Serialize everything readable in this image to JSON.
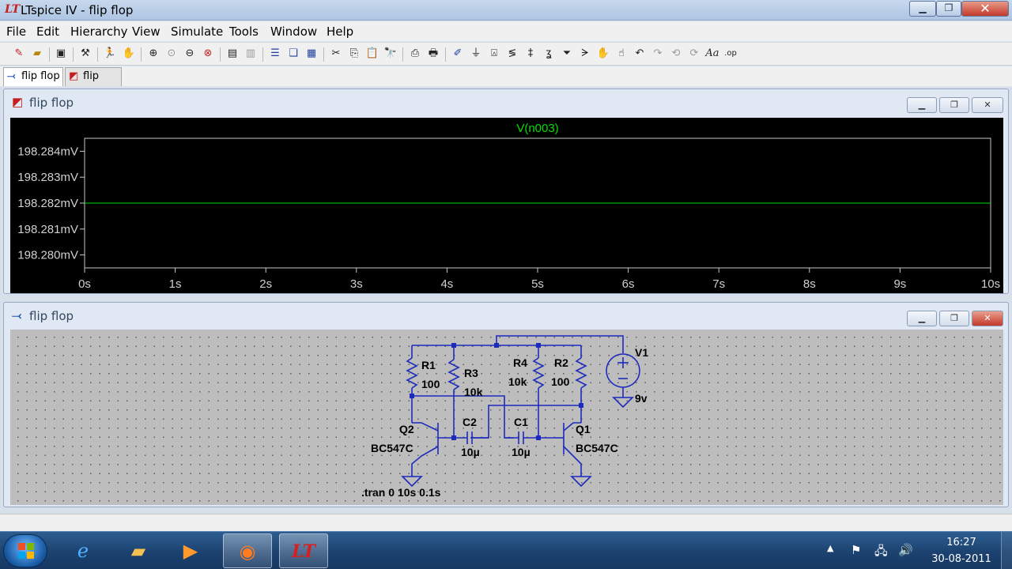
{
  "window": {
    "icon": "LT",
    "title": "LTspice IV - flip flop",
    "min_glyph": "▁",
    "max_glyph": "❐",
    "close_glyph": "✕"
  },
  "menu": {
    "file": "File",
    "edit": "Edit",
    "hierarchy": "Hierarchy",
    "view": "View",
    "simulate": "Simulate",
    "tools": "Tools",
    "window": "Window",
    "help": "Help"
  },
  "toolbar_icons": [
    "new-schematic-icon",
    "open-icon",
    "save-icon",
    "control-panel-icon",
    "run-icon",
    "halt-icon",
    "zoom-in-icon",
    "zoom-out-icon",
    "zoom-fit-icon",
    "zoom-cancel-icon",
    "autorange-icon",
    "grid-icon",
    "tile-horizontal-icon",
    "cascade-icon",
    "tile-vertical-icon",
    "cut-icon",
    "copy-icon",
    "paste-icon",
    "find-icon",
    "print-setup-icon",
    "print-icon",
    "wire-icon",
    "ground-icon",
    "label-icon",
    "resistor-icon",
    "capacitor-icon",
    "inductor-icon",
    "diode-icon",
    "component-icon",
    "move-icon",
    "drag-icon",
    "undo-icon",
    "redo-icon",
    "rotate-icon",
    "mirror-icon",
    "text-icon",
    "spice-directive-icon"
  ],
  "tabs": [
    {
      "label": "flip flop",
      "icon": "schematic-icon"
    },
    {
      "label": "flip flop",
      "icon": "waveform-icon"
    }
  ],
  "waveform_window": {
    "title": "flip flop",
    "trace_label": "V(n003)",
    "trace_color": "#00e000",
    "chart_data": {
      "type": "line",
      "title": "V(n003)",
      "x": [
        0,
        10
      ],
      "y": [
        198.282,
        198.282
      ],
      "xlim": [
        0,
        10
      ],
      "ylim": [
        198.2795,
        198.2845
      ],
      "x_ticks": [
        "0s",
        "1s",
        "2s",
        "3s",
        "4s",
        "5s",
        "6s",
        "7s",
        "8s",
        "9s",
        "10s"
      ],
      "y_ticks": [
        "198.284mV",
        "198.283mV",
        "198.282mV",
        "198.281mV",
        "198.280mV"
      ],
      "y_tick_values": [
        198.284,
        198.283,
        198.282,
        198.281,
        198.28
      ],
      "grid": false
    }
  },
  "schematic_window": {
    "title": "flip flop",
    "components": {
      "r1_name": "R1",
      "r1_value": "100",
      "r3_name": "R3",
      "r3_value": "10k",
      "r4_name": "R4",
      "r4_value": "10k",
      "r2_name": "R2",
      "r2_value": "100",
      "v1_name": "V1",
      "v1_value": "9v",
      "c2_name": "C2",
      "c2_value": "10µ",
      "c1_name": "C1",
      "c1_value": "10µ",
      "q2_name": "Q2",
      "q2_value": "BC547C",
      "q1_name": "Q1",
      "q1_value": "BC547C",
      "directive": ".tran 0 10s 0.1s"
    },
    "wire_color": "#1d2bbd"
  },
  "taskbar": {
    "apps": [
      "internet-explorer-icon",
      "explorer-folder-icon",
      "media-player-icon",
      "firefox-icon",
      "ltspice-icon"
    ],
    "clock_time": "16:27",
    "clock_date": "30-08-2011"
  }
}
